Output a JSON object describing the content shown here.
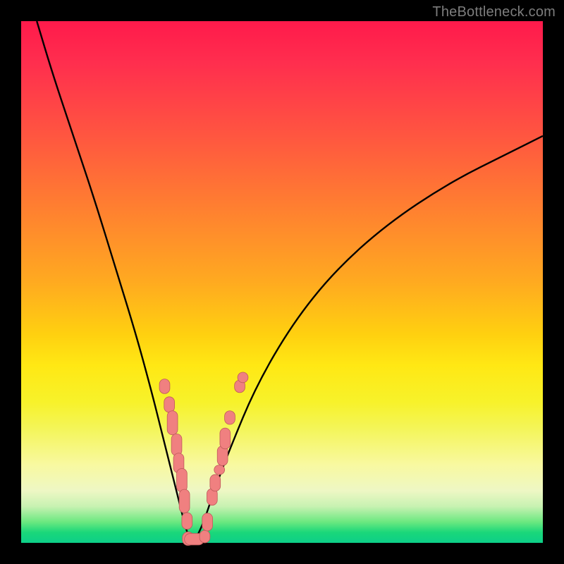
{
  "watermark": "TheBottleneck.com",
  "colors": {
    "curve": "#000000",
    "marker_fill": "#f08080",
    "marker_stroke": "#be5a5a"
  },
  "chart_data": {
    "type": "line",
    "title": "",
    "xlabel": "",
    "ylabel": "",
    "xlim": [
      0,
      100
    ],
    "ylim": [
      0,
      100
    ],
    "series": [
      {
        "name": "left-curve",
        "x": [
          3,
          6,
          10,
          14,
          18,
          22,
          25,
          27,
          29,
          30.5,
          31.5,
          32.2,
          32.8
        ],
        "y": [
          100,
          90,
          78,
          66,
          53,
          40,
          29,
          21,
          13,
          7,
          3,
          1,
          0
        ]
      },
      {
        "name": "right-curve",
        "x": [
          32.8,
          33.6,
          35,
          37,
          40,
          45,
          52,
          60,
          70,
          82,
          94,
          100
        ],
        "y": [
          0,
          1,
          4,
          10,
          18,
          30,
          42,
          52,
          61,
          69,
          75,
          78
        ]
      }
    ],
    "markers": {
      "name": "highlighted-points",
      "points": [
        {
          "x": 27.5,
          "y": 30.0,
          "w": 2.0,
          "h": 2.8
        },
        {
          "x": 28.4,
          "y": 26.5,
          "w": 2.0,
          "h": 3.0
        },
        {
          "x": 29.0,
          "y": 23.0,
          "w": 2.0,
          "h": 4.6
        },
        {
          "x": 29.8,
          "y": 18.8,
          "w": 2.0,
          "h": 4.2
        },
        {
          "x": 30.2,
          "y": 15.3,
          "w": 2.0,
          "h": 3.8
        },
        {
          "x": 30.8,
          "y": 12.0,
          "w": 2.0,
          "h": 4.5
        },
        {
          "x": 31.3,
          "y": 8.0,
          "w": 2.0,
          "h": 4.5
        },
        {
          "x": 31.8,
          "y": 4.2,
          "w": 2.0,
          "h": 3.2
        },
        {
          "x": 32.0,
          "y": 0.8,
          "w": 2.2,
          "h": 2.6
        },
        {
          "x": 33.2,
          "y": 0.7,
          "w": 3.8,
          "h": 2.2
        },
        {
          "x": 35.2,
          "y": 1.2,
          "w": 2.0,
          "h": 2.4
        },
        {
          "x": 35.7,
          "y": 4.0,
          "w": 2.0,
          "h": 3.4
        },
        {
          "x": 36.6,
          "y": 8.8,
          "w": 2.0,
          "h": 3.2
        },
        {
          "x": 37.2,
          "y": 11.5,
          "w": 2.0,
          "h": 3.2
        },
        {
          "x": 38.0,
          "y": 14.0,
          "w": 2.0,
          "h": 1.8
        },
        {
          "x": 38.6,
          "y": 16.7,
          "w": 2.0,
          "h": 3.8
        },
        {
          "x": 39.1,
          "y": 20.0,
          "w": 2.0,
          "h": 4.0
        },
        {
          "x": 40.0,
          "y": 24.0,
          "w": 2.0,
          "h": 2.6
        },
        {
          "x": 41.9,
          "y": 30.0,
          "w": 2.0,
          "h": 2.4
        },
        {
          "x": 42.5,
          "y": 31.7,
          "w": 2.0,
          "h": 2.0
        }
      ]
    }
  }
}
